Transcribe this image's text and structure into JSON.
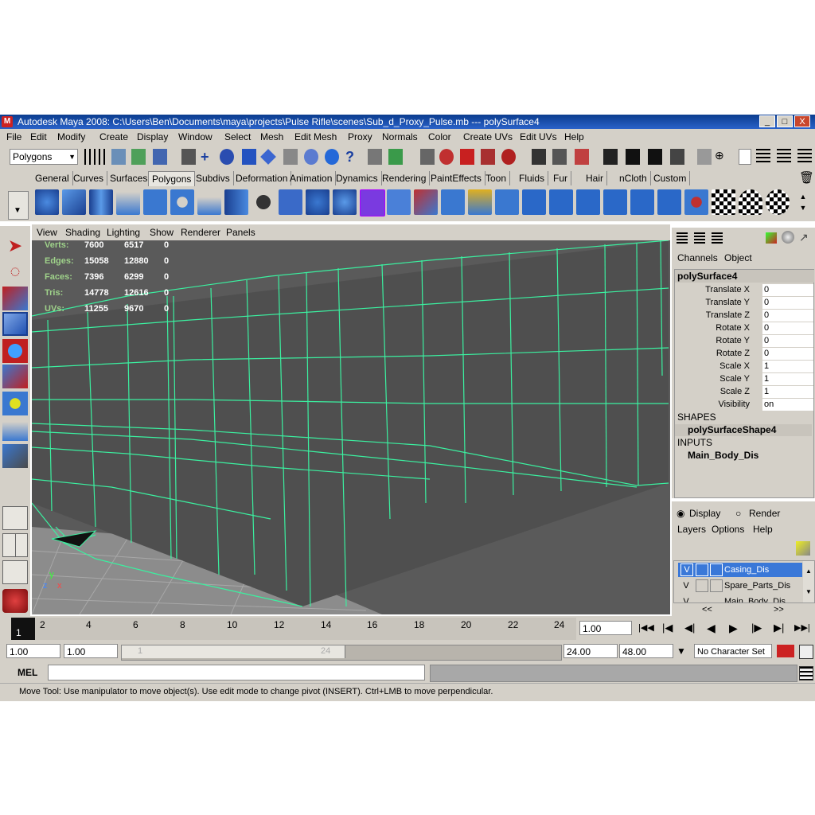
{
  "window": {
    "title": "Autodesk Maya 2008: C:\\Users\\Ben\\Documents\\maya\\projects\\Pulse Rifle\\scenes\\Sub_d_Proxy_Pulse.mb   ---   polySurface4",
    "min_label": "_",
    "max_label": "□",
    "close_label": "X"
  },
  "menu": [
    "File",
    "Edit",
    "Modify",
    "Create",
    "Display",
    "Window",
    "Select",
    "Mesh",
    "Edit Mesh",
    "Proxy",
    "Normals",
    "Color",
    "Create UVs",
    "Edit UVs",
    "Help"
  ],
  "toolbar": {
    "mode": "Polygons"
  },
  "shelf": {
    "tabs": [
      "General",
      "Curves",
      "Surfaces",
      "Polygons",
      "Subdivs",
      "Deformation",
      "Animation",
      "Dynamics",
      "Rendering",
      "PaintEffects",
      "Toon",
      "Fluids",
      "Fur",
      "Hair",
      "nCloth",
      "Custom"
    ],
    "active_tab": "Polygons"
  },
  "panel_menu": [
    "View",
    "Shading",
    "Lighting",
    "Show",
    "Renderer",
    "Panels"
  ],
  "hud": {
    "rows": [
      {
        "label": "Verts:",
        "a": "7600",
        "b": "6517",
        "c": "0"
      },
      {
        "label": "Edges:",
        "a": "15058",
        "b": "12880",
        "c": "0"
      },
      {
        "label": "Faces:",
        "a": "7396",
        "b": "6299",
        "c": "0"
      },
      {
        "label": "Tris:",
        "a": "14778",
        "b": "12616",
        "c": "0"
      },
      {
        "label": "UVs:",
        "a": "11255",
        "b": "9670",
        "c": "0"
      }
    ],
    "axis_labels": {
      "y": "y",
      "z": "z",
      "x": "x"
    }
  },
  "channel_box": {
    "tabs": {
      "channels": "Channels",
      "object": "Object"
    },
    "object_name": "polySurface4",
    "attributes": [
      {
        "name": "Translate X",
        "value": "0"
      },
      {
        "name": "Translate Y",
        "value": "0"
      },
      {
        "name": "Translate Z",
        "value": "0"
      },
      {
        "name": "Rotate X",
        "value": "0"
      },
      {
        "name": "Rotate Y",
        "value": "0"
      },
      {
        "name": "Rotate Z",
        "value": "0"
      },
      {
        "name": "Scale X",
        "value": "1"
      },
      {
        "name": "Scale Y",
        "value": "1"
      },
      {
        "name": "Scale Z",
        "value": "1"
      },
      {
        "name": "Visibility",
        "value": "on"
      }
    ],
    "shapes_header": "SHAPES",
    "shape_name": "polySurfaceShape4",
    "inputs_header": "INPUTS",
    "input_name": "Main_Body_Dis"
  },
  "layers": {
    "display_label": "Display",
    "render_label": "Render",
    "menu": [
      "Layers",
      "Options",
      "Help"
    ],
    "rows": [
      {
        "v": "V",
        "name": "Casing_Dis",
        "selected": true
      },
      {
        "v": "V",
        "name": "Spare_Parts_Dis",
        "selected": false
      },
      {
        "v": "V",
        "name": "Main_Body_Dis",
        "selected": false
      }
    ],
    "nav_left": "<<",
    "nav_right": ">>"
  },
  "time_slider": {
    "ticks": [
      "2",
      "4",
      "6",
      "8",
      "10",
      "12",
      "14",
      "16",
      "18",
      "20",
      "22",
      "24"
    ],
    "current_frame": "1",
    "current_time_field": "1.00"
  },
  "range": {
    "start_time": "1.00",
    "playback_start": "1.00",
    "range_label_left": "1",
    "range_label_right": "24",
    "playback_end": "24.00",
    "end_time": "48.00",
    "character_set": "No Character Set"
  },
  "command_line": {
    "label": "MEL"
  },
  "help_line": "Move Tool: Use manipulator to move object(s). Use edit mode to change pivot (INSERT).  Ctrl+LMB to move perpendicular.",
  "colors": {
    "wire": "#3bf0a0",
    "viewport_bg": "#5a5a5a",
    "grid": "#9a9a9a",
    "highlight": "#3a78d8"
  }
}
